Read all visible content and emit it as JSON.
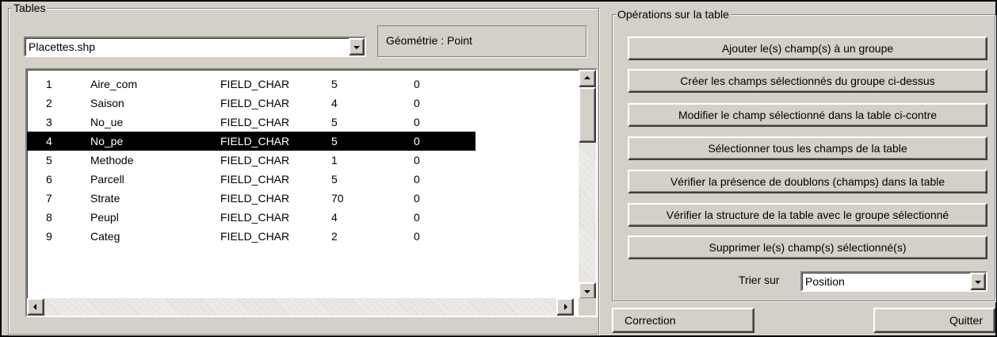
{
  "tables_group": {
    "legend": "Tables",
    "file_combo_value": "Placettes.shp",
    "geometry_label": "Géométrie : Point"
  },
  "fields_list": {
    "rows": [
      {
        "num": "1",
        "name": "Aire_com",
        "type": "FIELD_CHAR",
        "width": "5",
        "dec": "0"
      },
      {
        "num": "2",
        "name": "Saison",
        "type": "FIELD_CHAR",
        "width": "4",
        "dec": "0"
      },
      {
        "num": "3",
        "name": "No_ue",
        "type": "FIELD_CHAR",
        "width": "5",
        "dec": "0"
      },
      {
        "num": "4",
        "name": "No_pe",
        "type": "FIELD_CHAR",
        "width": "5",
        "dec": "0",
        "selected": true
      },
      {
        "num": "5",
        "name": "Methode",
        "type": "FIELD_CHAR",
        "width": "1",
        "dec": "0"
      },
      {
        "num": "6",
        "name": "Parcell",
        "type": "FIELD_CHAR",
        "width": "5",
        "dec": "0"
      },
      {
        "num": "7",
        "name": "Strate",
        "type": "FIELD_CHAR",
        "width": "70",
        "dec": "0"
      },
      {
        "num": "8",
        "name": "Peupl",
        "type": "FIELD_CHAR",
        "width": "4",
        "dec": "0"
      },
      {
        "num": "9",
        "name": "Categ",
        "type": "FIELD_CHAR",
        "width": "2",
        "dec": "0"
      }
    ]
  },
  "operations_group": {
    "legend": "Opérations sur la table",
    "buttons": [
      "Ajouter le(s) champ(s) à un groupe",
      "Créer les champs sélectionnés du groupe ci-dessus",
      "Modifier le champ sélectionné dans la table ci-contre",
      "Sélectionner tous les champs de la table",
      "Vérifier la présence de doublons (champs) dans la table",
      "Vérifier la structure de la table avec le groupe sélectionné",
      "Supprimer le(s) champ(s) sélectionné(s)"
    ],
    "sort_label": "Trier sur",
    "sort_value": "Position"
  },
  "footer": {
    "correction_label": "Correction",
    "quit_label": "Quitter"
  },
  "colors": {
    "dialog_bg": "#d4d0c8",
    "selection_bg": "#000000",
    "selection_text": "#ffffff"
  }
}
